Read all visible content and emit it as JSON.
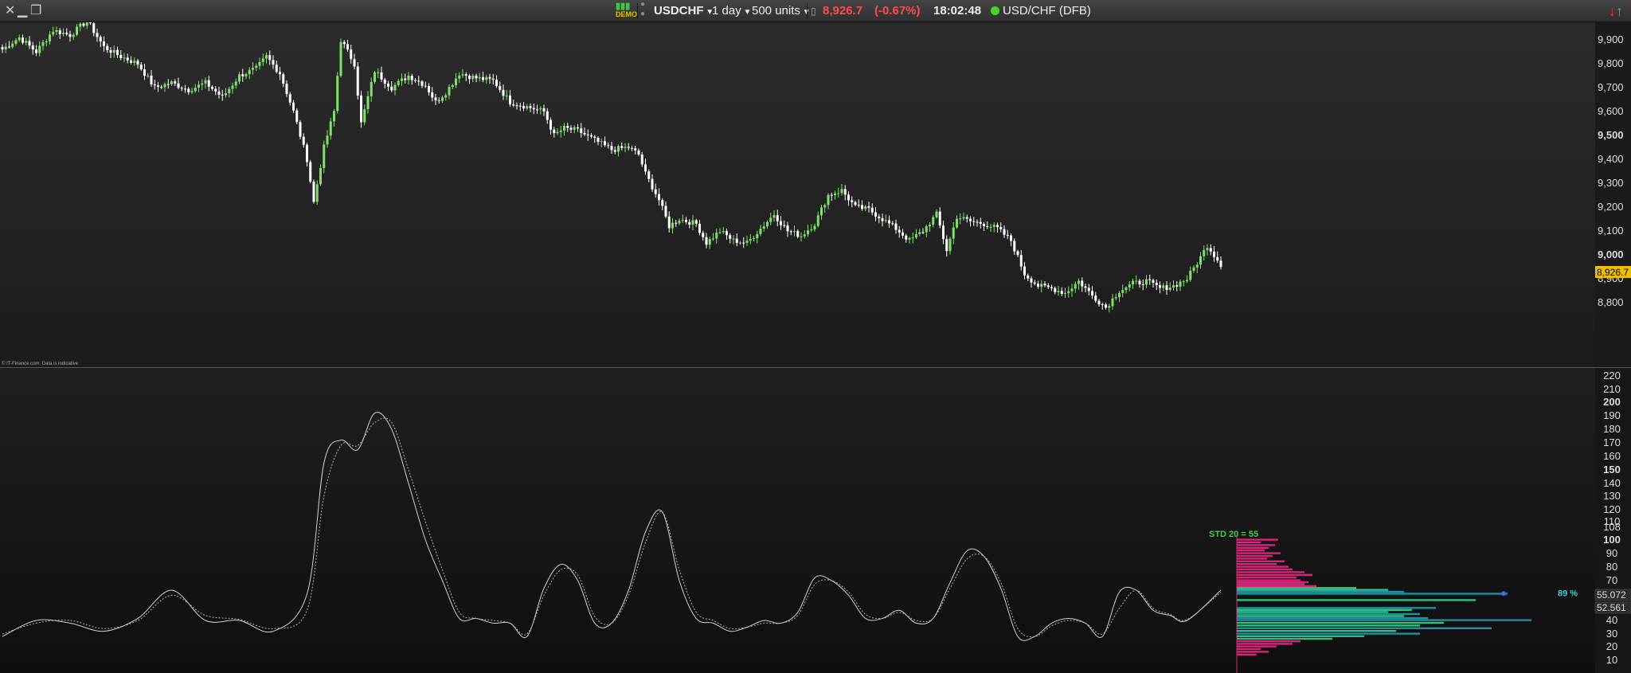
{
  "toolbar": {
    "demo_badge": "DEMO",
    "symbol": "USDCHF",
    "timeframe": "1 day",
    "units": "500 units",
    "price": "8,926.7",
    "change": "(-0.67%)",
    "time": "18:02:48",
    "instrument": "USD/CHF (DFB)"
  },
  "price_chart": {
    "copyright": "© IT-Finance.com. Data is indicative",
    "last_price_label": "8,926.7",
    "axis_labels": [
      {
        "text": "9,900",
        "value": 9900,
        "bold": false
      },
      {
        "text": "9,800",
        "value": 9800,
        "bold": false
      },
      {
        "text": "9,700",
        "value": 9700,
        "bold": false
      },
      {
        "text": "9,600",
        "value": 9600,
        "bold": false
      },
      {
        "text": "9,500",
        "value": 9500,
        "bold": true
      },
      {
        "text": "9,400",
        "value": 9400,
        "bold": false
      },
      {
        "text": "9,300",
        "value": 9300,
        "bold": false
      },
      {
        "text": "9,200",
        "value": 9200,
        "bold": false
      },
      {
        "text": "9,100",
        "value": 9100,
        "bold": false
      },
      {
        "text": "9,000",
        "value": 9000,
        "bold": true
      },
      {
        "text": "8,900",
        "value": 8900,
        "bold": false
      },
      {
        "text": "8,800",
        "value": 8800,
        "bold": false
      }
    ]
  },
  "indicator": {
    "std_label": "STD 20  = 55",
    "percent_label": "89 %",
    "value_label_1": "55.072",
    "value_label_2": "52.561",
    "axis_labels": [
      {
        "text": "220",
        "value": 220,
        "bold": false
      },
      {
        "text": "210",
        "value": 210,
        "bold": false
      },
      {
        "text": "200",
        "value": 200,
        "bold": true
      },
      {
        "text": "190",
        "value": 190,
        "bold": false
      },
      {
        "text": "180",
        "value": 180,
        "bold": false
      },
      {
        "text": "170",
        "value": 170,
        "bold": false
      },
      {
        "text": "160",
        "value": 160,
        "bold": false
      },
      {
        "text": "150",
        "value": 150,
        "bold": true
      },
      {
        "text": "140",
        "value": 140,
        "bold": false
      },
      {
        "text": "130",
        "value": 130,
        "bold": false
      },
      {
        "text": "120",
        "value": 120,
        "bold": false
      },
      {
        "text": "110",
        "value": 110,
        "bold": false
      },
      {
        "text": "108",
        "value": 108,
        "bold": false
      },
      {
        "text": "100",
        "value": 100,
        "bold": true
      },
      {
        "text": "90",
        "value": 90,
        "bold": false
      },
      {
        "text": "80",
        "value": 80,
        "bold": false
      },
      {
        "text": "70",
        "value": 70,
        "bold": false
      },
      {
        "text": "40",
        "value": 40,
        "bold": false
      },
      {
        "text": "30",
        "value": 30,
        "bold": false
      },
      {
        "text": "20",
        "value": 20,
        "bold": false
      },
      {
        "text": "10",
        "value": 10,
        "bold": false
      }
    ]
  },
  "colors": {
    "bull": "#7fe06a",
    "bear": "#ffffff",
    "hist_magenta": "#d6247a",
    "hist_green": "#2fbf7e",
    "hist_teal": "#1e8fa0",
    "std_text": "#3fd23f",
    "pct_text": "#33d6e0",
    "last_price_bg": "#f0c000",
    "poc_marker": "#3a6cff"
  },
  "chart_data": [
    {
      "type": "candlestick",
      "title": "USDCHF",
      "ylim": [
        8700,
        9950
      ],
      "anchors": [
        [
          0,
          9860
        ],
        [
          5,
          9910
        ],
        [
          10,
          9850
        ],
        [
          15,
          9940
        ],
        [
          20,
          9920
        ],
        [
          25,
          9980
        ],
        [
          30,
          9870
        ],
        [
          35,
          9830
        ],
        [
          40,
          9800
        ],
        [
          45,
          9700
        ],
        [
          50,
          9720
        ],
        [
          55,
          9690
        ],
        [
          60,
          9720
        ],
        [
          65,
          9660
        ],
        [
          70,
          9750
        ],
        [
          75,
          9780
        ],
        [
          78,
          9830
        ],
        [
          82,
          9760
        ],
        [
          86,
          9600
        ],
        [
          90,
          9400
        ],
        [
          92,
          9220
        ],
        [
          95,
          9450
        ],
        [
          98,
          9600
        ],
        [
          100,
          9900
        ],
        [
          104,
          9800
        ],
        [
          106,
          9550
        ],
        [
          110,
          9770
        ],
        [
          115,
          9700
        ],
        [
          120,
          9750
        ],
        [
          125,
          9710
        ],
        [
          128,
          9640
        ],
        [
          131,
          9680
        ],
        [
          135,
          9760
        ],
        [
          140,
          9740
        ],
        [
          145,
          9730
        ],
        [
          150,
          9640
        ],
        [
          155,
          9620
        ],
        [
          160,
          9600
        ],
        [
          163,
          9500
        ],
        [
          166,
          9530
        ],
        [
          170,
          9520
        ],
        [
          175,
          9480
        ],
        [
          180,
          9440
        ],
        [
          185,
          9450
        ],
        [
          188,
          9420
        ],
        [
          190,
          9340
        ],
        [
          194,
          9230
        ],
        [
          197,
          9120
        ],
        [
          200,
          9150
        ],
        [
          205,
          9130
        ],
        [
          208,
          9050
        ],
        [
          212,
          9100
        ],
        [
          216,
          9060
        ],
        [
          220,
          9050
        ],
        [
          224,
          9110
        ],
        [
          228,
          9170
        ],
        [
          232,
          9100
        ],
        [
          236,
          9080
        ],
        [
          240,
          9130
        ],
        [
          244,
          9250
        ],
        [
          248,
          9270
        ],
        [
          252,
          9200
        ],
        [
          256,
          9190
        ],
        [
          260,
          9150
        ],
        [
          264,
          9110
        ],
        [
          268,
          9060
        ],
        [
          272,
          9100
        ],
        [
          276,
          9170
        ],
        [
          279,
          9020
        ],
        [
          282,
          9160
        ],
        [
          286,
          9140
        ],
        [
          290,
          9130
        ],
        [
          294,
          9110
        ],
        [
          298,
          9060
        ],
        [
          302,
          8920
        ],
        [
          306,
          8870
        ],
        [
          310,
          8860
        ],
        [
          314,
          8840
        ],
        [
          318,
          8890
        ],
        [
          322,
          8830
        ],
        [
          326,
          8780
        ],
        [
          330,
          8850
        ],
        [
          334,
          8880
        ],
        [
          338,
          8890
        ],
        [
          342,
          8860
        ],
        [
          346,
          8870
        ],
        [
          350,
          8900
        ],
        [
          354,
          8990
        ],
        [
          356,
          9040
        ],
        [
          360,
          8960
        ]
      ]
    },
    {
      "type": "line",
      "title": "",
      "ylim": [
        0,
        220
      ],
      "x": [
        0,
        10,
        20,
        30,
        40,
        50,
        60,
        70,
        80,
        90,
        95,
        100,
        105,
        110,
        115,
        120,
        125,
        130,
        135,
        140,
        145,
        150,
        155,
        160,
        165,
        170,
        175,
        180,
        185,
        190,
        195,
        200,
        205,
        210,
        215,
        220,
        225,
        230,
        235,
        240,
        245,
        250,
        255,
        260,
        265,
        270,
        275,
        280,
        285,
        290,
        295,
        300,
        305,
        310,
        315,
        320,
        325,
        330,
        335,
        340,
        345,
        350,
        360
      ],
      "series": [
        {
          "values": [
            28,
            40,
            38,
            32,
            42,
            60,
            40,
            40,
            32,
            56,
            155,
            172,
            165,
            192,
            180,
            140,
            100,
            70,
            42,
            42,
            38,
            38,
            28,
            62,
            82,
            70,
            38,
            38,
            60,
            105,
            118,
            70,
            42,
            38,
            32,
            35,
            40,
            38,
            48,
            72,
            70,
            55,
            42,
            42,
            50,
            38,
            42,
            68,
            92,
            88,
            62,
            28,
            28,
            38,
            42,
            38,
            28,
            58,
            60,
            50,
            45,
            40,
            60
          ]
        },
        {
          "style": "dotted",
          "values": [
            30,
            38,
            40,
            34,
            40,
            55,
            45,
            41,
            34,
            50,
            130,
            168,
            168,
            185,
            185,
            150,
            110,
            78,
            48,
            42,
            40,
            38,
            30,
            55,
            78,
            74,
            44,
            38,
            55,
            98,
            118,
            78,
            48,
            40,
            34,
            35,
            38,
            38,
            45,
            66,
            70,
            58,
            46,
            42,
            48,
            40,
            42,
            62,
            86,
            88,
            68,
            34,
            28,
            36,
            40,
            38,
            30,
            52,
            60,
            52,
            46,
            41,
            58
          ]
        }
      ]
    },
    {
      "type": "bar",
      "orientation": "horizontal",
      "title": "",
      "bars": [
        {
          "y": 100,
          "v": 52,
          "c": "hist_magenta"
        },
        {
          "y": 98,
          "v": 30,
          "c": "hist_magenta"
        },
        {
          "y": 96,
          "v": 48,
          "c": "hist_magenta"
        },
        {
          "y": 94,
          "v": 40,
          "c": "hist_magenta"
        },
        {
          "y": 92,
          "v": 35,
          "c": "hist_magenta"
        },
        {
          "y": 90,
          "v": 55,
          "c": "hist_magenta"
        },
        {
          "y": 88,
          "v": 45,
          "c": "hist_magenta"
        },
        {
          "y": 86,
          "v": 38,
          "c": "hist_magenta"
        },
        {
          "y": 84,
          "v": 60,
          "c": "hist_magenta"
        },
        {
          "y": 82,
          "v": 50,
          "c": "hist_magenta"
        },
        {
          "y": 80,
          "v": 65,
          "c": "hist_magenta"
        },
        {
          "y": 78,
          "v": 70,
          "c": "hist_magenta"
        },
        {
          "y": 76,
          "v": 85,
          "c": "hist_magenta"
        },
        {
          "y": 74,
          "v": 95,
          "c": "hist_magenta"
        },
        {
          "y": 72,
          "v": 75,
          "c": "hist_magenta"
        },
        {
          "y": 70,
          "v": 80,
          "c": "hist_magenta"
        },
        {
          "y": 68,
          "v": 90,
          "c": "hist_magenta"
        },
        {
          "y": 66,
          "v": 85,
          "c": "hist_magenta"
        },
        {
          "y": 64,
          "v": 100,
          "c": "hist_magenta"
        },
        {
          "y": 62,
          "v": 150,
          "c": "hist_green"
        },
        {
          "y": 60,
          "v": 190,
          "c": "hist_green"
        },
        {
          "y": 58,
          "v": 210,
          "c": "hist_teal"
        },
        {
          "y": 56,
          "v": 340,
          "c": "hist_teal"
        },
        {
          "y": 54,
          "v": 300,
          "c": "hist_green"
        },
        {
          "y": 52,
          "v": 250,
          "c": "hist_teal"
        },
        {
          "y": 50,
          "v": 220,
          "c": "hist_green"
        },
        {
          "y": 48,
          "v": 190,
          "c": "hist_green"
        },
        {
          "y": 46,
          "v": 230,
          "c": "hist_teal"
        },
        {
          "y": 44,
          "v": 210,
          "c": "hist_green"
        },
        {
          "y": 42,
          "v": 240,
          "c": "hist_teal"
        },
        {
          "y": 40,
          "v": 370,
          "c": "hist_teal"
        },
        {
          "y": 38,
          "v": 260,
          "c": "hist_green"
        },
        {
          "y": 36,
          "v": 230,
          "c": "hist_green"
        },
        {
          "y": 34,
          "v": 320,
          "c": "hist_teal"
        },
        {
          "y": 32,
          "v": 200,
          "c": "hist_green"
        },
        {
          "y": 30,
          "v": 230,
          "c": "hist_teal"
        },
        {
          "y": 28,
          "v": 160,
          "c": "hist_green"
        },
        {
          "y": 26,
          "v": 120,
          "c": "hist_green"
        },
        {
          "y": 24,
          "v": 80,
          "c": "hist_magenta"
        },
        {
          "y": 22,
          "v": 70,
          "c": "hist_magenta"
        },
        {
          "y": 20,
          "v": 50,
          "c": "hist_magenta"
        },
        {
          "y": 18,
          "v": 30,
          "c": "hist_magenta"
        },
        {
          "y": 16,
          "v": 40,
          "c": "hist_magenta"
        },
        {
          "y": 14,
          "v": 25,
          "c": "hist_magenta"
        }
      ]
    }
  ]
}
